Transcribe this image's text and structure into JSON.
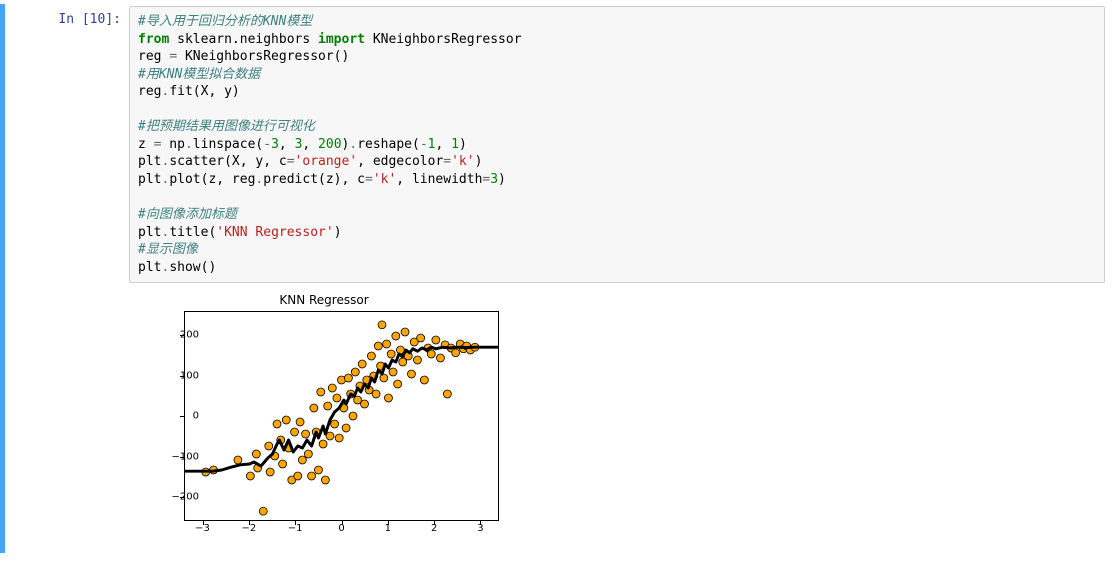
{
  "cell": {
    "prompt": "In [10]:",
    "code_tokens": [
      {
        "t": "#导入用于回归分析的KNN模型",
        "c": "c-cmt"
      },
      {
        "t": "\n"
      },
      {
        "t": "from",
        "c": "c-kw"
      },
      {
        "t": " "
      },
      {
        "t": "sklearn.neighbors",
        "c": "c-nm"
      },
      {
        "t": " "
      },
      {
        "t": "import",
        "c": "c-kw"
      },
      {
        "t": " "
      },
      {
        "t": "KNeighborsRegressor",
        "c": "c-nm"
      },
      {
        "t": "\n"
      },
      {
        "t": "reg ",
        "c": "c-nm"
      },
      {
        "t": "=",
        "c": "c-op"
      },
      {
        "t": " KNeighborsRegressor()",
        "c": "c-nm"
      },
      {
        "t": "\n"
      },
      {
        "t": "#用KNN模型拟合数据",
        "c": "c-cmt"
      },
      {
        "t": "\n"
      },
      {
        "t": "reg",
        "c": "c-nm"
      },
      {
        "t": ".",
        "c": "c-op"
      },
      {
        "t": "fit(X, y)",
        "c": "c-nm"
      },
      {
        "t": "\n"
      },
      {
        "t": "\n"
      },
      {
        "t": "#把预期结果用图像进行可视化",
        "c": "c-cmt"
      },
      {
        "t": "\n"
      },
      {
        "t": "z ",
        "c": "c-nm"
      },
      {
        "t": "=",
        "c": "c-op"
      },
      {
        "t": " np",
        "c": "c-nm"
      },
      {
        "t": ".",
        "c": "c-op"
      },
      {
        "t": "linspace(",
        "c": "c-nm"
      },
      {
        "t": "-",
        "c": "c-op"
      },
      {
        "t": "3",
        "c": "c-num"
      },
      {
        "t": ", ",
        "c": "c-nm"
      },
      {
        "t": "3",
        "c": "c-num"
      },
      {
        "t": ", ",
        "c": "c-nm"
      },
      {
        "t": "200",
        "c": "c-num"
      },
      {
        "t": ")",
        "c": "c-nm"
      },
      {
        "t": ".",
        "c": "c-op"
      },
      {
        "t": "reshape(",
        "c": "c-nm"
      },
      {
        "t": "-",
        "c": "c-op"
      },
      {
        "t": "1",
        "c": "c-num"
      },
      {
        "t": ", ",
        "c": "c-nm"
      },
      {
        "t": "1",
        "c": "c-num"
      },
      {
        "t": ")",
        "c": "c-nm"
      },
      {
        "t": "\n"
      },
      {
        "t": "plt",
        "c": "c-nm"
      },
      {
        "t": ".",
        "c": "c-op"
      },
      {
        "t": "scatter(X, y, c",
        "c": "c-nm"
      },
      {
        "t": "=",
        "c": "c-op"
      },
      {
        "t": "'orange'",
        "c": "c-str"
      },
      {
        "t": ", edgecolor",
        "c": "c-nm"
      },
      {
        "t": "=",
        "c": "c-op"
      },
      {
        "t": "'k'",
        "c": "c-str"
      },
      {
        "t": ")",
        "c": "c-nm"
      },
      {
        "t": "\n"
      },
      {
        "t": "plt",
        "c": "c-nm"
      },
      {
        "t": ".",
        "c": "c-op"
      },
      {
        "t": "plot(z, reg",
        "c": "c-nm"
      },
      {
        "t": ".",
        "c": "c-op"
      },
      {
        "t": "predict(z), c",
        "c": "c-nm"
      },
      {
        "t": "=",
        "c": "c-op"
      },
      {
        "t": "'k'",
        "c": "c-str"
      },
      {
        "t": ", linewidth",
        "c": "c-nm"
      },
      {
        "t": "=",
        "c": "c-op"
      },
      {
        "t": "3",
        "c": "c-num"
      },
      {
        "t": ")",
        "c": "c-nm"
      },
      {
        "t": "\n"
      },
      {
        "t": "\n"
      },
      {
        "t": "#向图像添加标题",
        "c": "c-cmt"
      },
      {
        "t": "\n"
      },
      {
        "t": "plt",
        "c": "c-nm"
      },
      {
        "t": ".",
        "c": "c-op"
      },
      {
        "t": "title(",
        "c": "c-nm"
      },
      {
        "t": "'KNN Regressor'",
        "c": "c-str"
      },
      {
        "t": ")",
        "c": "c-nm"
      },
      {
        "t": "\n"
      },
      {
        "t": "#显示图像",
        "c": "c-cmt"
      },
      {
        "t": "\n"
      },
      {
        "t": "plt",
        "c": "c-nm"
      },
      {
        "t": ".",
        "c": "c-op"
      },
      {
        "t": "show()",
        "c": "c-nm"
      }
    ]
  },
  "chart_data": {
    "type": "scatter+line",
    "title": "KNN Regressor",
    "xlim": [
      -3.4,
      3.4
    ],
    "ylim": [
      -260,
      260
    ],
    "xticks": [
      -3,
      -2,
      -1,
      0,
      1,
      2,
      3
    ],
    "yticks": [
      -200,
      -100,
      0,
      100,
      200
    ],
    "scatter": {
      "color": "#ffa500",
      "edgecolor": "#000000",
      "points": [
        [
          -2.95,
          -140
        ],
        [
          -2.78,
          -135
        ],
        [
          -2.25,
          -110
        ],
        [
          -1.98,
          -150
        ],
        [
          -1.85,
          -95
        ],
        [
          -1.82,
          -130
        ],
        [
          -1.7,
          -238
        ],
        [
          -1.58,
          -75
        ],
        [
          -1.55,
          -140
        ],
        [
          -1.45,
          -100
        ],
        [
          -1.4,
          -20
        ],
        [
          -1.32,
          -60
        ],
        [
          -1.28,
          -120
        ],
        [
          -1.2,
          -10
        ],
        [
          -1.15,
          -80
        ],
        [
          -1.08,
          -160
        ],
        [
          -1.02,
          -40
        ],
        [
          -0.95,
          -150
        ],
        [
          -0.9,
          -15
        ],
        [
          -0.85,
          -110
        ],
        [
          -0.78,
          -45
        ],
        [
          -0.72,
          -95
        ],
        [
          -0.65,
          -150
        ],
        [
          -0.6,
          20
        ],
        [
          -0.55,
          -40
        ],
        [
          -0.5,
          -135
        ],
        [
          -0.45,
          60
        ],
        [
          -0.4,
          -70
        ],
        [
          -0.35,
          -160
        ],
        [
          -0.3,
          25
        ],
        [
          -0.25,
          -50
        ],
        [
          -0.2,
          70
        ],
        [
          -0.15,
          -20
        ],
        [
          -0.1,
          45
        ],
        [
          -0.05,
          -55
        ],
        [
          0.0,
          90
        ],
        [
          0.05,
          20
        ],
        [
          0.1,
          -30
        ],
        [
          0.15,
          95
        ],
        [
          0.2,
          55
        ],
        [
          0.25,
          0
        ],
        [
          0.3,
          110
        ],
        [
          0.35,
          40
        ],
        [
          0.4,
          75
        ],
        [
          0.45,
          130
        ],
        [
          0.5,
          30
        ],
        [
          0.55,
          90
        ],
        [
          0.6,
          65
        ],
        [
          0.65,
          150
        ],
        [
          0.7,
          100
        ],
        [
          0.75,
          55
        ],
        [
          0.8,
          175
        ],
        [
          0.85,
          125
        ],
        [
          0.88,
          228
        ],
        [
          0.92,
          95
        ],
        [
          0.98,
          180
        ],
        [
          1.02,
          45
        ],
        [
          1.08,
          155
        ],
        [
          1.12,
          110
        ],
        [
          1.18,
          200
        ],
        [
          1.22,
          80
        ],
        [
          1.28,
          165
        ],
        [
          1.33,
          135
        ],
        [
          1.38,
          210
        ],
        [
          1.45,
          150
        ],
        [
          1.52,
          105
        ],
        [
          1.58,
          185
        ],
        [
          1.65,
          140
        ],
        [
          1.72,
          195
        ],
        [
          1.8,
          90
        ],
        [
          1.88,
          170
        ],
        [
          1.95,
          155
        ],
        [
          2.05,
          190
        ],
        [
          2.15,
          145
        ],
        [
          2.25,
          178
        ],
        [
          2.3,
          55
        ],
        [
          2.38,
          170
        ],
        [
          2.48,
          158
        ],
        [
          2.58,
          180
        ],
        [
          2.65,
          168
        ],
        [
          2.72,
          175
        ],
        [
          2.8,
          165
        ],
        [
          2.9,
          172
        ]
      ]
    },
    "line": {
      "color": "#000000",
      "width": 3,
      "points": [
        [
          -3.4,
          -138
        ],
        [
          -3.0,
          -138
        ],
        [
          -2.8,
          -138
        ],
        [
          -2.6,
          -135
        ],
        [
          -2.4,
          -128
        ],
        [
          -2.2,
          -122
        ],
        [
          -2.0,
          -120
        ],
        [
          -1.9,
          -115
        ],
        [
          -1.75,
          -125
        ],
        [
          -1.6,
          -105
        ],
        [
          -1.5,
          -95
        ],
        [
          -1.4,
          -70
        ],
        [
          -1.35,
          -60
        ],
        [
          -1.25,
          -85
        ],
        [
          -1.15,
          -60
        ],
        [
          -1.05,
          -90
        ],
        [
          -0.95,
          -75
        ],
        [
          -0.85,
          -80
        ],
        [
          -0.75,
          -60
        ],
        [
          -0.65,
          -75
        ],
        [
          -0.55,
          -40
        ],
        [
          -0.5,
          -55
        ],
        [
          -0.4,
          -25
        ],
        [
          -0.35,
          -45
        ],
        [
          -0.25,
          -10
        ],
        [
          -0.15,
          10
        ],
        [
          -0.05,
          20
        ],
        [
          0.05,
          40
        ],
        [
          0.1,
          30
        ],
        [
          0.2,
          55
        ],
        [
          0.28,
          50
        ],
        [
          0.35,
          70
        ],
        [
          0.42,
          60
        ],
        [
          0.5,
          80
        ],
        [
          0.58,
          70
        ],
        [
          0.65,
          95
        ],
        [
          0.72,
          85
        ],
        [
          0.8,
          115
        ],
        [
          0.88,
          105
        ],
        [
          0.95,
          130
        ],
        [
          1.02,
          120
        ],
        [
          1.1,
          140
        ],
        [
          1.18,
          135
        ],
        [
          1.25,
          155
        ],
        [
          1.32,
          148
        ],
        [
          1.4,
          165
        ],
        [
          1.48,
          158
        ],
        [
          1.55,
          168
        ],
        [
          1.65,
          162
        ],
        [
          1.75,
          170
        ],
        [
          1.85,
          165
        ],
        [
          1.95,
          172
        ],
        [
          2.05,
          168
        ],
        [
          2.2,
          172
        ],
        [
          2.35,
          170
        ],
        [
          2.5,
          172
        ],
        [
          2.7,
          171
        ],
        [
          2.9,
          172
        ],
        [
          3.1,
          172
        ],
        [
          3.4,
          172
        ]
      ]
    }
  }
}
